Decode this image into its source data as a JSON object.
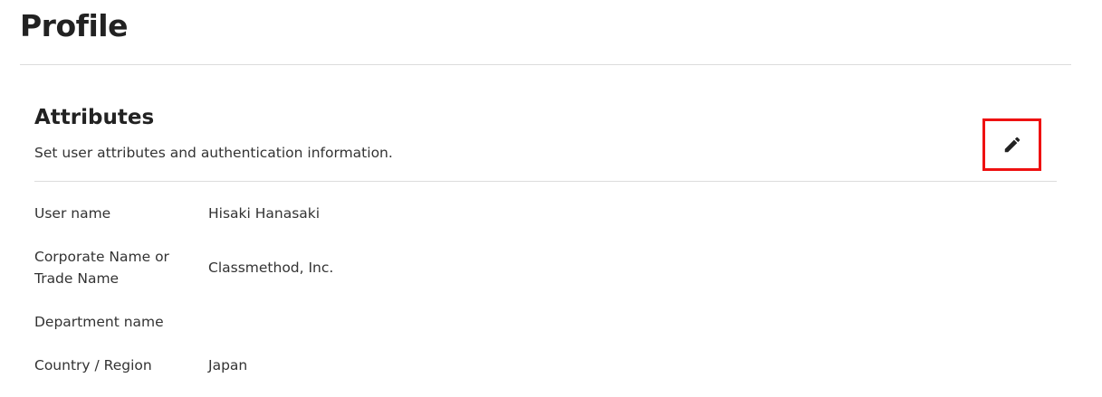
{
  "page": {
    "title": "Profile"
  },
  "attributes_section": {
    "title": "Attributes",
    "description": "Set user attributes and authentication information.",
    "edit_icon": "pencil-icon",
    "highlight_color": "#ee1111"
  },
  "attributes": [
    {
      "label": "User name",
      "value": "Hisaki Hanasaki"
    },
    {
      "label_line1": "Corporate Name or",
      "label_line2": "Trade Name",
      "value": "Classmethod, Inc."
    },
    {
      "label": "Department name",
      "value": ""
    },
    {
      "label": "Country / Region",
      "value": "Japan"
    }
  ]
}
